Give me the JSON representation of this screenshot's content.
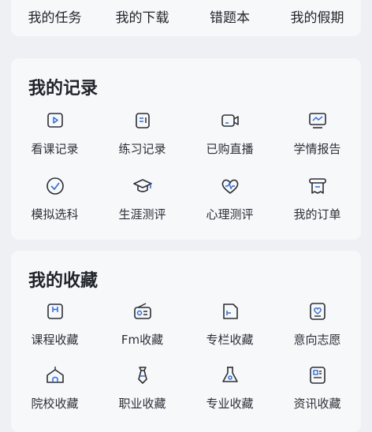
{
  "top_row": [
    "我的任务",
    "我的下载",
    "错题本",
    "我的假期"
  ],
  "records": {
    "title": "我的记录",
    "items": [
      {
        "label": "看课记录",
        "icon": "play-icon"
      },
      {
        "label": "练习记录",
        "icon": "practice-icon"
      },
      {
        "label": "已购直播",
        "icon": "video-icon"
      },
      {
        "label": "学情报告",
        "icon": "report-icon"
      },
      {
        "label": "模拟选科",
        "icon": "check-circle-icon"
      },
      {
        "label": "生涯测评",
        "icon": "graduation-cap-icon"
      },
      {
        "label": "心理测评",
        "icon": "heart-pulse-icon"
      },
      {
        "label": "我的订单",
        "icon": "receipt-icon"
      }
    ]
  },
  "favorites": {
    "title": "我的收藏",
    "items": [
      {
        "label": "课程收藏",
        "icon": "course-icon"
      },
      {
        "label": "Fm收藏",
        "icon": "radio-icon"
      },
      {
        "label": "专栏收藏",
        "icon": "column-icon"
      },
      {
        "label": "意向志愿",
        "icon": "heart-box-icon"
      },
      {
        "label": "院校收藏",
        "icon": "school-icon"
      },
      {
        "label": "职业收藏",
        "icon": "tie-icon"
      },
      {
        "label": "专业收藏",
        "icon": "flask-icon"
      },
      {
        "label": "资讯收藏",
        "icon": "news-icon"
      }
    ]
  },
  "colors": {
    "accent": "#2e6bd8",
    "card_bg": "#f7f8fa",
    "page_bg": "#eef0f3"
  }
}
